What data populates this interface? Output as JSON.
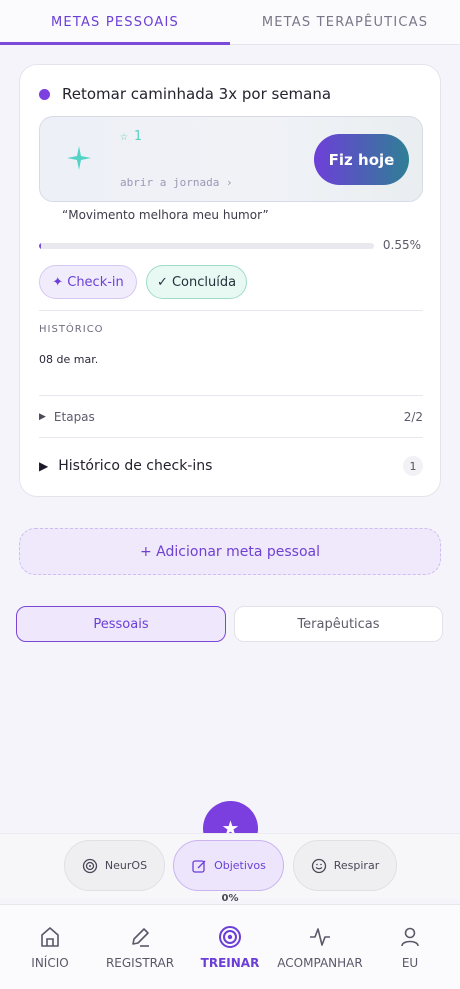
{
  "tabs": {
    "personal": "METAS PESSOAIS",
    "therapeutic": "METAS TERAPÊUTICAS"
  },
  "goal": {
    "title": "Retomar caminhada 3x por semana",
    "stars": "1",
    "open_journey": "abrir a jornada ›",
    "do_today": "Fiz hoje",
    "quote": "“Movimento melhora meu humor”",
    "progress_label": "0.55%",
    "progress_value": 0.0055,
    "checkin_chip": "✦ Check-in",
    "done_chip": "✓ Concluída",
    "history_title": "HISTÓRICO",
    "history_date": "08 de mar.",
    "steps_label": "Etapas",
    "steps_count": "2/2",
    "checkins_label": "Histórico de check-ins",
    "checkins_count": "1"
  },
  "add_goal": "+ Adicionar meta pessoal",
  "segments": {
    "personal": "Pessoais",
    "therapeutic": "Terapêuticas"
  },
  "fab_icon": "star-icon",
  "pills": {
    "neuro": "NeurOS",
    "objectives": "Objetivos",
    "breathe": "Respirar"
  },
  "percent": "0%",
  "nav": {
    "home": "INÍCIO",
    "register": "REGISTRAR",
    "train": "TREINAR",
    "track": "ACOMPANHAR",
    "me": "EU"
  },
  "colors": {
    "accent": "#7c4ad9",
    "teal": "#4fd0c2"
  }
}
